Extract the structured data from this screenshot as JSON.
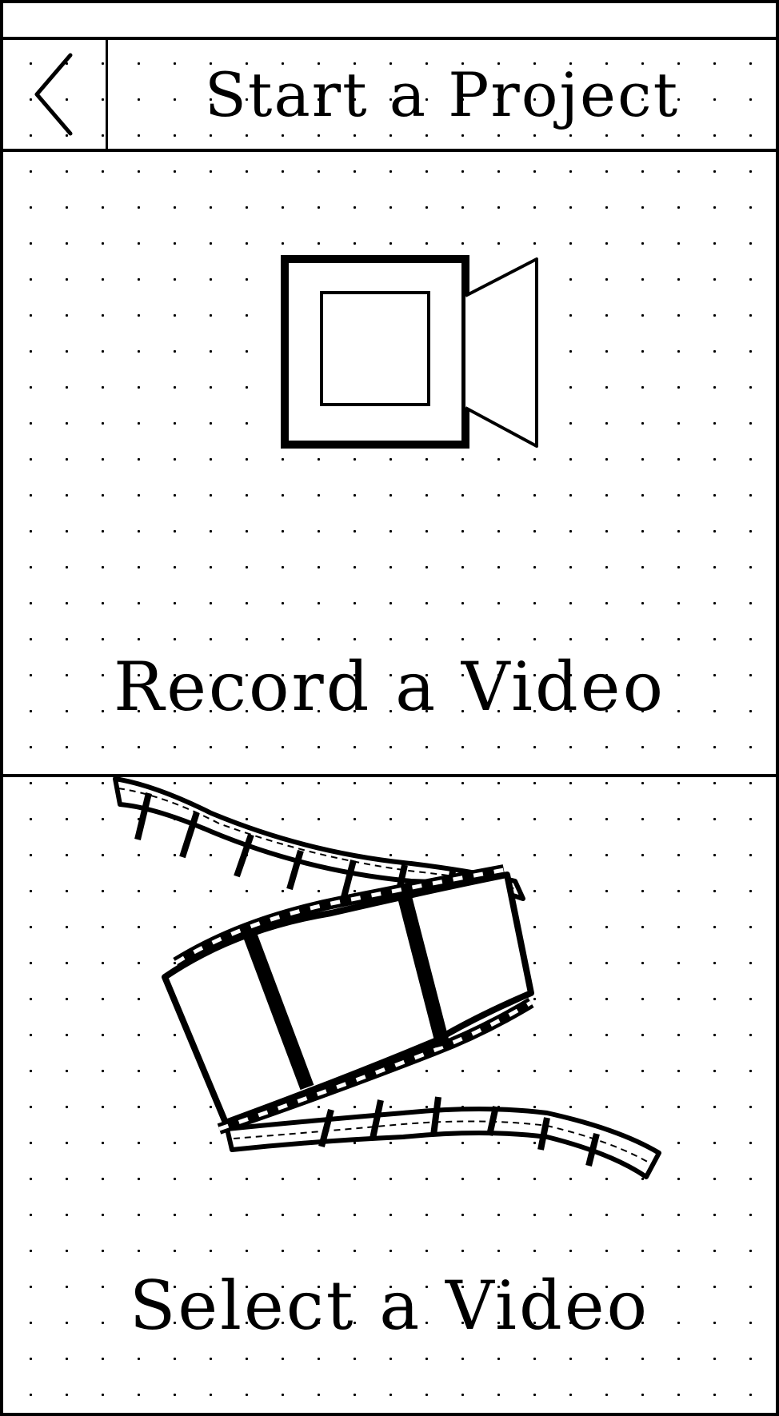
{
  "header": {
    "title": "Start a Project",
    "back_icon": "chevron-left-icon"
  },
  "record": {
    "label": "Record a Video",
    "icon": "video-camera-icon"
  },
  "select": {
    "label": "Select a Video",
    "icon": "film-strip-icon"
  }
}
